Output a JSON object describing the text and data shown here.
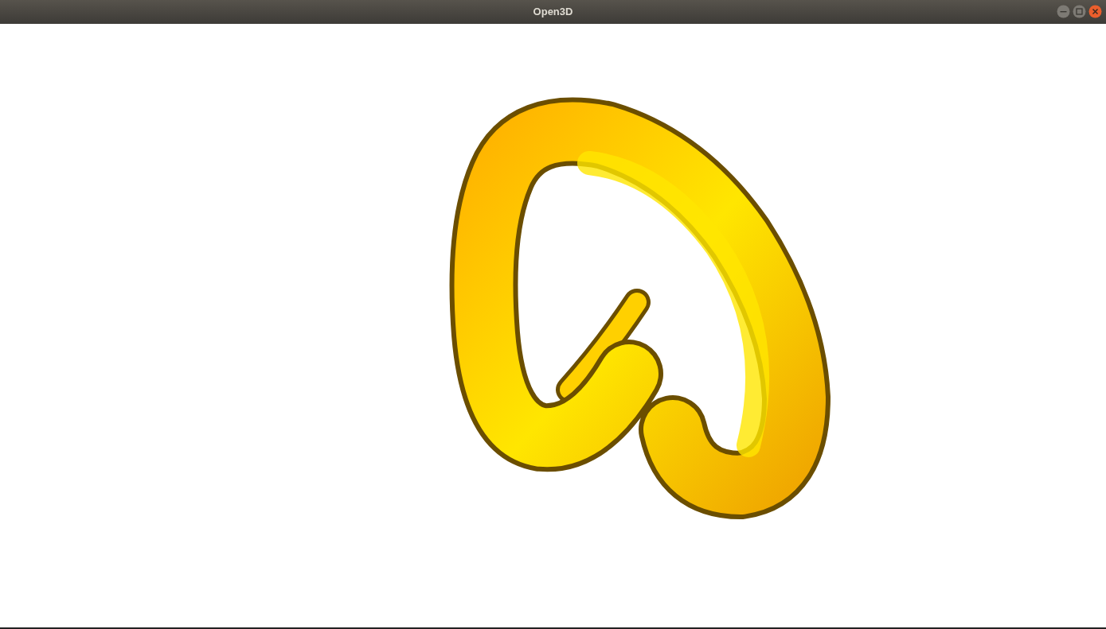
{
  "window": {
    "title": "Open3D"
  }
}
